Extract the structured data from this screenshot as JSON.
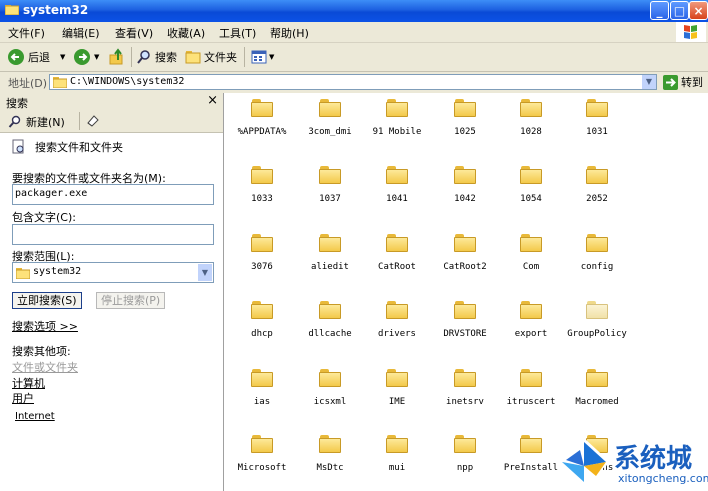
{
  "window": {
    "title": "system32",
    "controls": [
      "_",
      "□",
      "×"
    ]
  },
  "menu": [
    "文件(F)",
    "编辑(E)",
    "查看(V)",
    "收藏(A)",
    "工具(T)",
    "帮助(H)"
  ],
  "toolbar": {
    "back": "后退",
    "search": "搜索",
    "folders": "文件夹"
  },
  "address": {
    "label": "地址(D)",
    "value": "C:\\WINDOWS\\system32",
    "go": "转到"
  },
  "search_pane": {
    "title": "搜索",
    "new": "新建(N)",
    "heading": "搜索文件和文件夹",
    "name_label": "要搜索的文件或文件夹名为(M):",
    "name_value": "packager.exe",
    "text_label": "包含文字(C):",
    "text_value": "",
    "scope_label": "搜索范围(L):",
    "scope_value": "system32",
    "search_now": "立即搜索(S)",
    "stop": "停止搜索(P)",
    "options": "搜索选项 >>",
    "other": "搜索其他项:",
    "other_items": [
      "文件或文件夹",
      "计算机",
      "用户"
    ],
    "internet": "Internet"
  },
  "folders": [
    "%APPDATA%",
    "3com_dmi",
    "91 Mobile",
    "1025",
    "1028",
    "1031",
    "1033",
    "1037",
    "1041",
    "1042",
    "1054",
    "2052",
    "3076",
    "aliedit",
    "CatRoot",
    "CatRoot2",
    "Com",
    "config",
    "dhcp",
    "dllcache",
    "drivers",
    "DRVSTORE",
    "export",
    "GroupPolicy",
    "ias",
    "icsxml",
    "IME",
    "inetsrv",
    "itruscert",
    "Macromed",
    "Microsoft",
    "MsDtc",
    "mui",
    "npp",
    "PreInstall",
    "Prefns"
  ],
  "watermark": {
    "text": "系统城",
    "url": "xitongcheng.com"
  }
}
